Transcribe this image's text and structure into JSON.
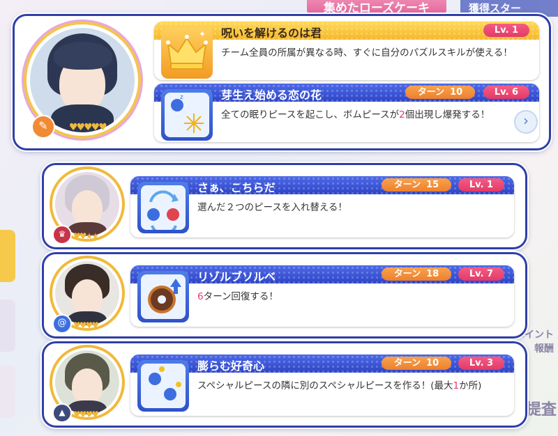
{
  "background": {
    "title_left": "集めたローズケーキ",
    "title_right": "獲得スター",
    "side_text_1": "ポイント",
    "side_text_2": "報酬",
    "side_text_3": "提査"
  },
  "cards": [
    {
      "leader_skill": {
        "name": "呪いを解けるのは君",
        "level": "Lv. 1",
        "description": "チーム全員の所属が異なる時、すぐに自分のパズルスキルが使える！",
        "icon": "crown-icon"
      },
      "skill": {
        "name": "芽生え始める恋の花",
        "turn_label": "ターン",
        "turn": "10",
        "level": "Lv. 6",
        "description_pre": "全ての眠りピースを起こし、ボムピースが",
        "description_hl": "2",
        "description_post": "個出現し爆発する！",
        "icon": "fireworks-icon"
      },
      "role_icon": "feather-icon"
    },
    {
      "skill": {
        "name": "さぁ、こちらだ",
        "turn_label": "ターン",
        "turn": "15",
        "level": "Lv. 1",
        "description": "選んだ２つのピースを入れ替える！",
        "icon": "swap-icon"
      },
      "role_icon": "crown-icon"
    },
    {
      "skill": {
        "name": "リゾルブソルベ",
        "turn_label": "ターン",
        "turn": "18",
        "level": "Lv. 7",
        "description_hl": "6",
        "description_post": "ターン回復する！",
        "icon": "donut-icon"
      },
      "role_icon": "swirl-icon"
    },
    {
      "skill": {
        "name": "膨らむ好奇心",
        "turn_label": "ターン",
        "turn": "10",
        "level": "Lv. 3",
        "description_pre": "スペシャルピースの隣に別のスペシャルピースを作る！(最大",
        "description_hl": "1",
        "description_post": "か所)",
        "icon": "idea-pieces-icon"
      },
      "role_icon": "graduation-cap-icon"
    }
  ],
  "colors": {
    "frame": "#2f3fa8",
    "header_blue": "#3a55d8",
    "header_gold": "#f7c23a",
    "turn_pill": "#f08a35",
    "level_pill": "#e84470",
    "highlight": "#e23b6b"
  }
}
